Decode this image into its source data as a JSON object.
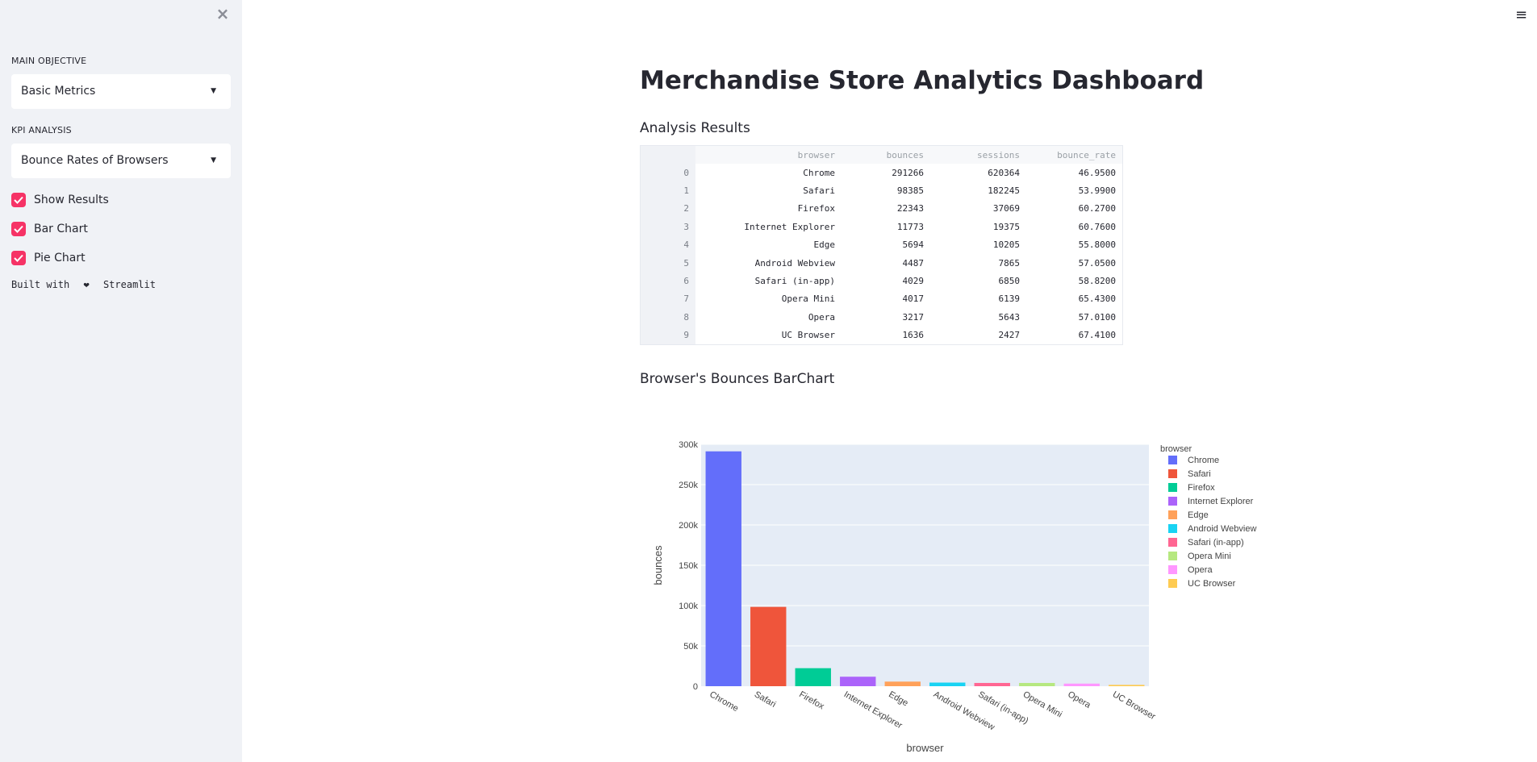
{
  "sidebar": {
    "close_icon": "×",
    "main_objective_label": "MAIN OBJECTIVE",
    "main_objective_value": "Basic Metrics",
    "kpi_label": "KPI ANALYSIS",
    "kpi_value": "Bounce Rates of Browsers",
    "checkboxes": [
      {
        "label": "Show Results",
        "checked": true
      },
      {
        "label": "Bar Chart",
        "checked": true
      },
      {
        "label": "Pie Chart",
        "checked": true
      }
    ],
    "built_with_prefix": "Built with",
    "built_with_suffix": "Streamlit",
    "heart": "❤"
  },
  "header": {
    "menu_icon": "≡"
  },
  "main": {
    "title": "Merchandise Store Analytics Dashboard",
    "analysis_heading": "Analysis Results",
    "bar_heading": "Browser's Bounces BarChart"
  },
  "table": {
    "columns": [
      "browser",
      "bounces",
      "sessions",
      "bounce_rate"
    ],
    "rows": [
      [
        "0",
        "Chrome",
        "291266",
        "620364",
        "46.9500"
      ],
      [
        "1",
        "Safari",
        "98385",
        "182245",
        "53.9900"
      ],
      [
        "2",
        "Firefox",
        "22343",
        "37069",
        "60.2700"
      ],
      [
        "3",
        "Internet Explorer",
        "11773",
        "19375",
        "60.7600"
      ],
      [
        "4",
        "Edge",
        "5694",
        "10205",
        "55.8000"
      ],
      [
        "5",
        "Android Webview",
        "4487",
        "7865",
        "57.0500"
      ],
      [
        "6",
        "Safari (in-app)",
        "4029",
        "6850",
        "58.8200"
      ],
      [
        "7",
        "Opera Mini",
        "4017",
        "6139",
        "65.4300"
      ],
      [
        "8",
        "Opera",
        "3217",
        "5643",
        "57.0100"
      ],
      [
        "9",
        "UC Browser",
        "1636",
        "2427",
        "67.4100"
      ]
    ]
  },
  "chart_data": {
    "type": "bar",
    "categories": [
      "Chrome",
      "Safari",
      "Firefox",
      "Internet Explorer",
      "Edge",
      "Android Webview",
      "Safari (in-app)",
      "Opera Mini",
      "Opera",
      "UC Browser"
    ],
    "values": [
      291266,
      98385,
      22343,
      11773,
      5694,
      4487,
      4029,
      4017,
      3217,
      1636
    ],
    "colors": [
      "#636efa",
      "#ef553b",
      "#00cc96",
      "#ab63fa",
      "#ffa15a",
      "#19d3f3",
      "#ff6692",
      "#b6e880",
      "#ff97ff",
      "#fecb52"
    ],
    "xlabel": "browser",
    "ylabel": "bounces",
    "legend_title": "browser",
    "legend_position": "right",
    "ylim": [
      0,
      300000
    ],
    "yticks": [
      0,
      50000,
      100000,
      150000,
      200000,
      250000,
      300000
    ],
    "ytick_labels": [
      "0",
      "50k",
      "100k",
      "150k",
      "200k",
      "250k",
      "300k"
    ],
    "grid": true
  }
}
